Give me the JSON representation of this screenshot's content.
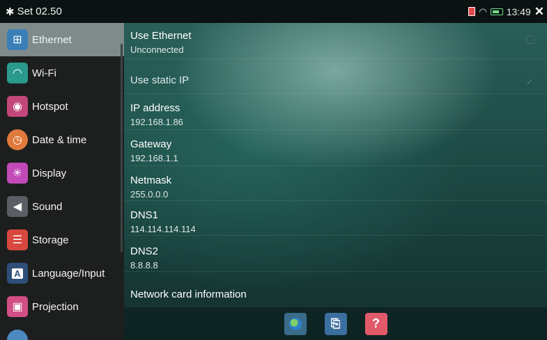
{
  "statusbar": {
    "title": "Set 02.50",
    "time": "13:49",
    "icons": [
      "gear-icon",
      "sim-icon",
      "wifi-icon",
      "battery-icon",
      "close-icon"
    ]
  },
  "sidebar": {
    "items": [
      {
        "label": "Ethernet",
        "icon": "ethernet-icon",
        "color": "#3a7fb8",
        "active": true
      },
      {
        "label": "Wi-Fi",
        "icon": "wifi-icon",
        "color": "#2a9a8c"
      },
      {
        "label": "Hotspot",
        "icon": "hotspot-icon",
        "color": "#c2477a"
      },
      {
        "label": "Date & time",
        "icon": "clock-icon",
        "color": "#e07a3a"
      },
      {
        "label": "Display",
        "icon": "display-icon",
        "color": "#c24ab8"
      },
      {
        "label": "Sound",
        "icon": "speaker-icon",
        "color": "#5a5f66"
      },
      {
        "label": "Storage",
        "icon": "storage-icon",
        "color": "#d8483f"
      },
      {
        "label": "Language/Input",
        "icon": "keyboard-icon",
        "color": "#2f4f7a"
      },
      {
        "label": "Projection",
        "icon": "projection-icon",
        "color": "#d24f86"
      }
    ]
  },
  "main": {
    "rows": [
      {
        "title": "Use Ethernet",
        "value": "Unconnected",
        "name": "use-ethernet"
      },
      {
        "title": "Use static IP",
        "value": "",
        "name": "use-static-ip"
      },
      {
        "title": "IP address",
        "value": "192.168.1.86",
        "name": "ip-address"
      },
      {
        "title": "Gateway",
        "value": "192.168.1.1",
        "name": "gateway"
      },
      {
        "title": "Netmask",
        "value": "255.0.0.0",
        "name": "netmask"
      },
      {
        "title": "DNS1",
        "value": "114.114.114.114",
        "name": "dns1"
      },
      {
        "title": "DNS2",
        "value": "8.8.8.8",
        "name": "dns2"
      },
      {
        "title": "Network card information",
        "value": "",
        "name": "network-card-info"
      }
    ]
  },
  "toolbar": {
    "buttons": [
      {
        "icon": "globe-icon",
        "color": "#3a6c8a"
      },
      {
        "icon": "share-icon",
        "color": "#3a6fa0"
      },
      {
        "icon": "help-icon",
        "label": "?",
        "color": "#e05a6a"
      }
    ]
  }
}
